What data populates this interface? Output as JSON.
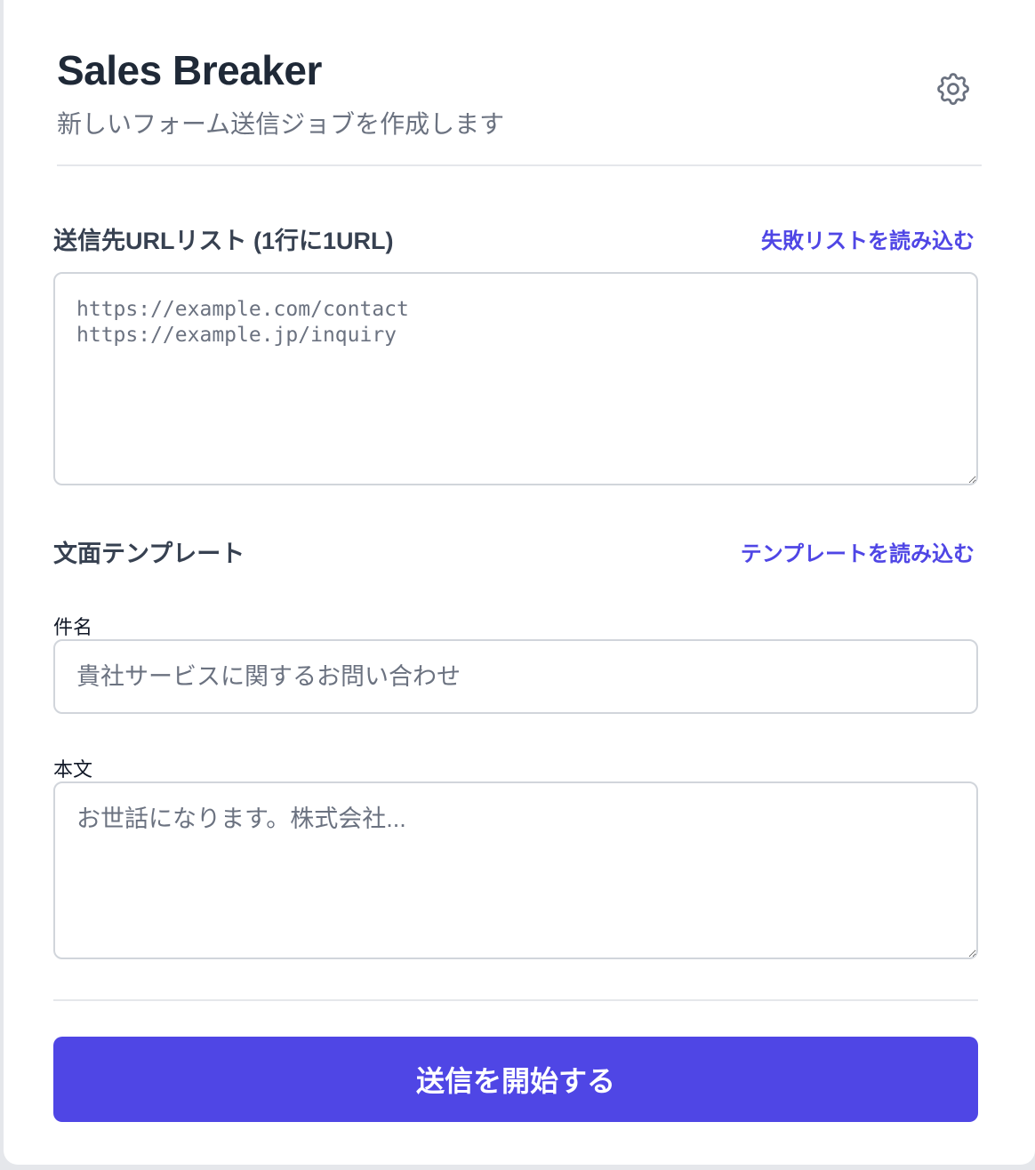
{
  "header": {
    "title": "Sales Breaker",
    "subtitle": "新しいフォーム送信ジョブを作成します",
    "settings_icon": "gear-icon"
  },
  "url_section": {
    "label": "送信先URLリスト (1行に1URL)",
    "load_link": "失敗リストを読み込む",
    "placeholder": "https://example.com/contact\nhttps://example.jp/inquiry",
    "value": ""
  },
  "template_section": {
    "label": "文面テンプレート",
    "load_link": "テンプレートを読み込む",
    "subject_label": "件名",
    "subject_placeholder": "貴社サービスに関するお問い合わせ",
    "subject_value": "",
    "body_label": "本文",
    "body_placeholder": "お世話になります。株式会社...",
    "body_value": ""
  },
  "submit": {
    "label": "送信を開始する"
  },
  "colors": {
    "accent": "#4f46e5",
    "title": "#1f2937",
    "muted": "#6b7280",
    "border": "#d1d5db",
    "background": "#e5e7eb"
  }
}
